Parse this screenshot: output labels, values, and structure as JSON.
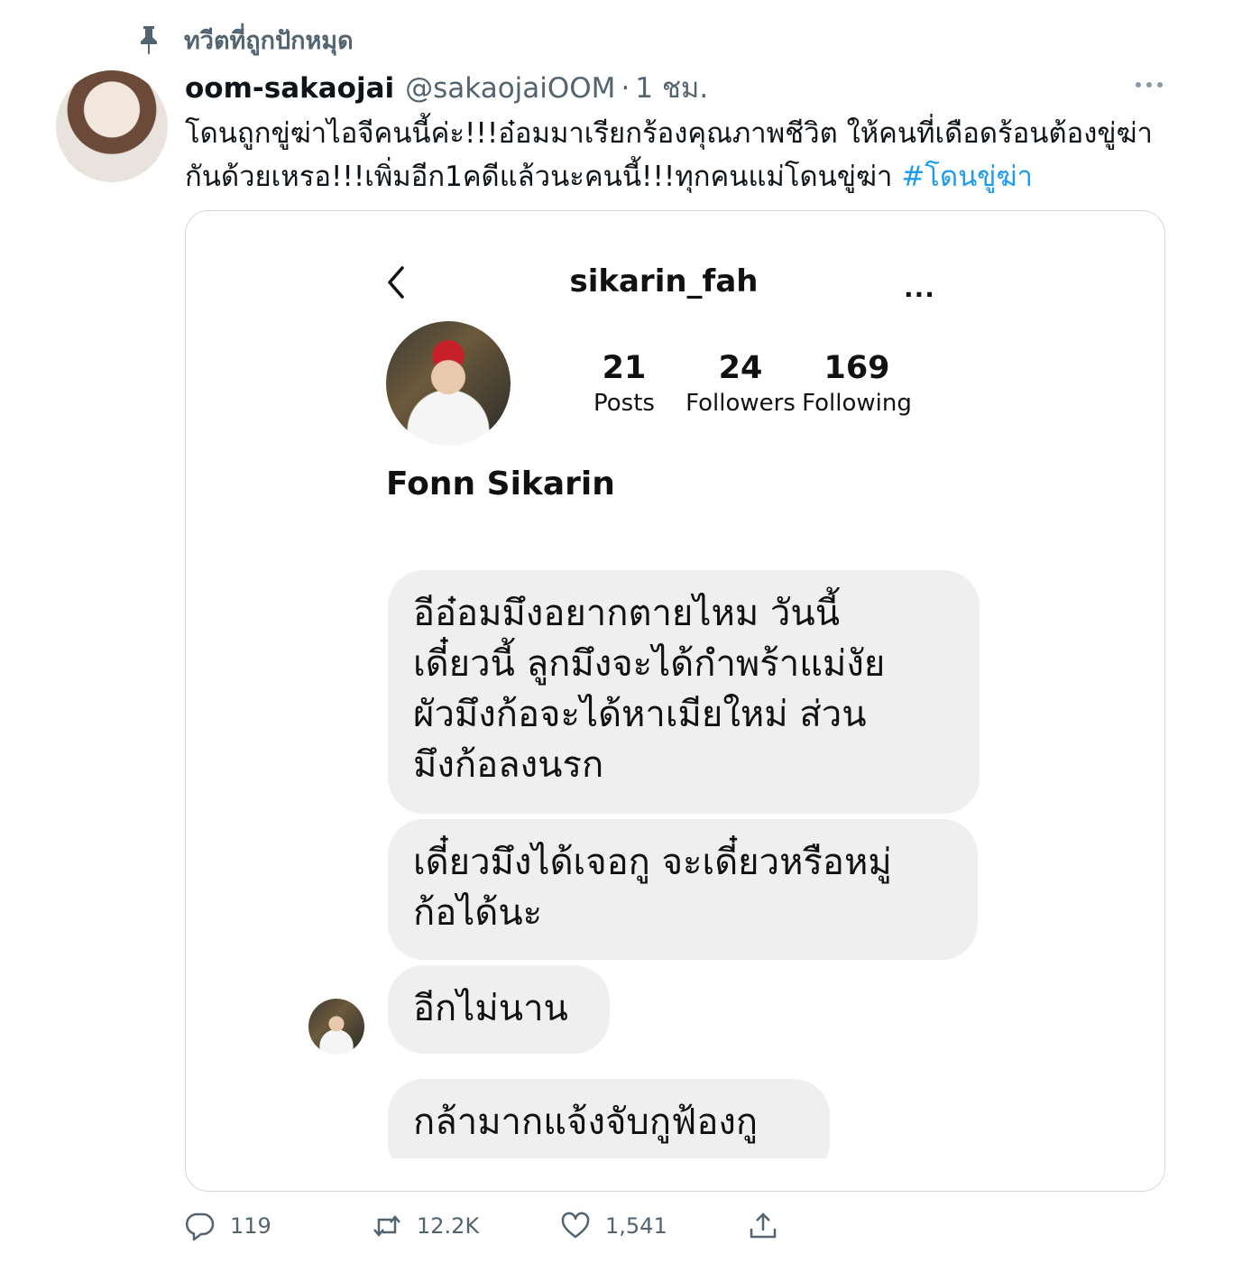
{
  "pinned": {
    "label": "ทวีตที่ถูกปักหมุด",
    "icon": "pin-icon"
  },
  "tweet": {
    "author_name": "oom-sakaojai",
    "author_handle": "@sakaojaiOOM",
    "separator": "·",
    "time": "1 ชม.",
    "text_line1": "โดนถูกขู่ฆ่าไอจีคนนี้ค่ะ!!!อ๋อมมาเรียกร้องคุณภาพชีวิต ให้คนที่เดือดร้อนต้องขู่ฆ่า",
    "text_line2": "กันด้วยเหรอ!!!เพิ่มอีก1คดีแล้วนะคนนี้!!!ทุกคนแม่โดนขู่ฆ่า ",
    "hashtag": "#โดนขู่ฆ่า"
  },
  "instagram": {
    "username": "sikarin_fah",
    "more": "···",
    "stats": [
      {
        "value": "21",
        "label": "Posts"
      },
      {
        "value": "24",
        "label": "Followers"
      },
      {
        "value": "169",
        "label": "Following"
      }
    ],
    "full_name": "Fonn Sikarin",
    "messages": [
      {
        "lines": [
          "อีอ๋อมมึงอยากตายไหม วันนี้",
          "เดี๋ยวนี้ ลูกมึงจะได้กำพร้าแม่งัย",
          "ผัวมึงก้อจะได้หาเมียใหม่ ส่วน",
          "มึงก้อลงนรก"
        ]
      },
      {
        "lines": [
          "เดี๋ยวมึงได้เจอกู จะเดี๋ยวหรือหมู่",
          "ก้อได้นะ"
        ]
      },
      {
        "lines": [
          "อีกไม่นาน"
        ]
      },
      {
        "lines": [
          "กล้ามากแจ้งจับกูฟ้องกู"
        ]
      }
    ]
  },
  "actions": {
    "reply": {
      "icon": "reply-icon",
      "count": "119"
    },
    "retweet": {
      "icon": "retweet-icon",
      "count": "12.2K"
    },
    "like": {
      "icon": "heart-icon",
      "count": "1,541"
    },
    "share": {
      "icon": "share-icon"
    }
  },
  "colors": {
    "link": "#1d9bf0",
    "secondary_text": "#536471",
    "bubble": "#efefef"
  }
}
